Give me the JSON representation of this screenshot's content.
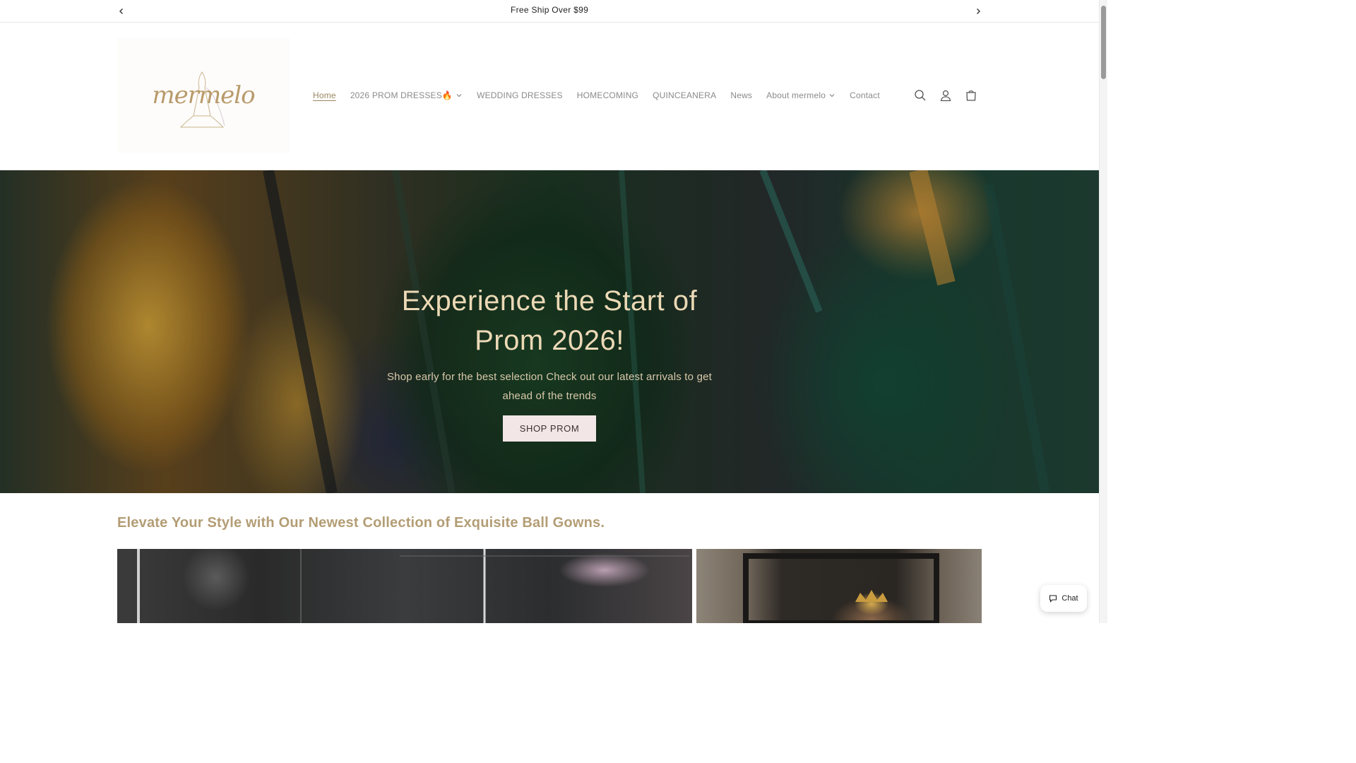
{
  "announcement": {
    "message": "Free Ship Over $99"
  },
  "header": {
    "logo_text": "mermelo",
    "nav": [
      {
        "label": "Home",
        "active": true,
        "dropdown": false
      },
      {
        "label": "2026 PROM DRESSES🔥",
        "active": false,
        "dropdown": true
      },
      {
        "label": "WEDDING DRESSES",
        "active": false,
        "dropdown": false
      },
      {
        "label": "HOMECOMING",
        "active": false,
        "dropdown": false
      },
      {
        "label": "QUINCEANERA",
        "active": false,
        "dropdown": false
      },
      {
        "label": "News",
        "active": false,
        "dropdown": false
      },
      {
        "label": "About mermelo",
        "active": false,
        "dropdown": true
      },
      {
        "label": "Contact",
        "active": false,
        "dropdown": false
      }
    ],
    "icons": [
      "search-icon",
      "account-icon",
      "cart-icon"
    ]
  },
  "hero": {
    "title_line1": "Experience the Start of",
    "title_line2": "Prom 2026!",
    "subtitle": "Shop early for the best selection Check out our latest arrivals to get ahead of the trends",
    "button_label": "SHOP PROM"
  },
  "collection": {
    "heading": "Elevate Your Style with Our Newest Collection of Exquisite Ball Gowns."
  },
  "chat": {
    "label": "Chat"
  },
  "colors": {
    "accent_gold": "#b39d75",
    "button_bg": "#f3e6e6",
    "hero_title": "#ecd9b6"
  }
}
